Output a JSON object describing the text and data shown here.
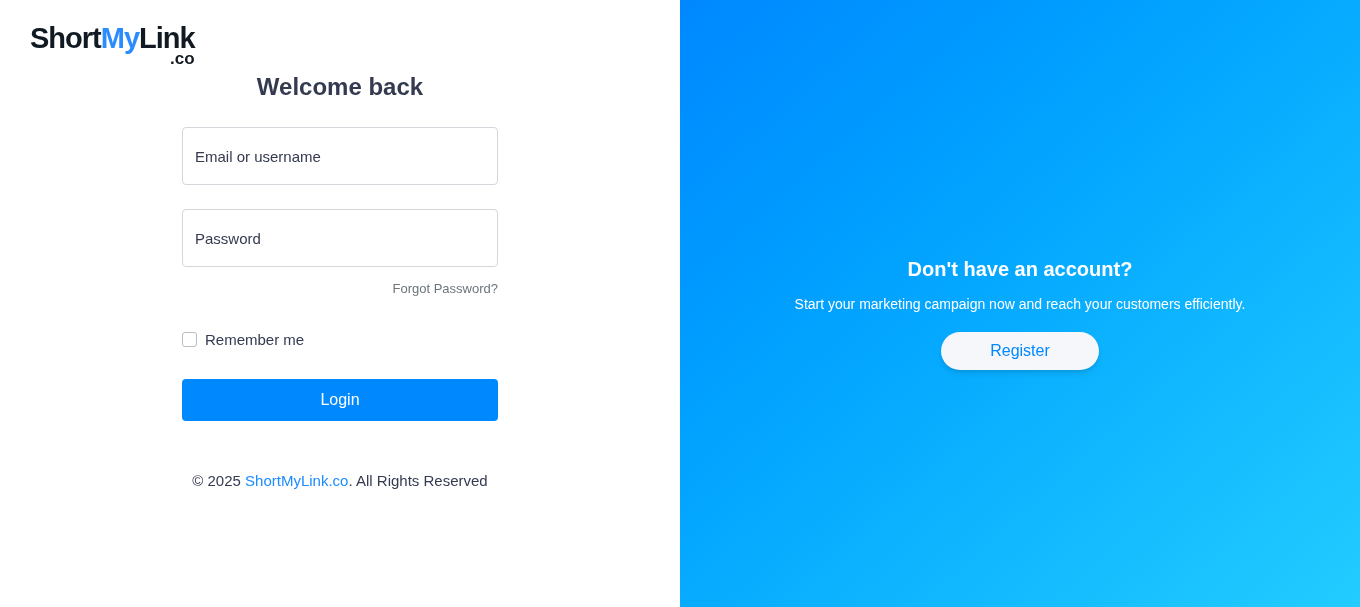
{
  "logo": {
    "parts": [
      {
        "text": "Short",
        "accent": false
      },
      {
        "text": "My",
        "accent": true
      },
      {
        "text": "Link",
        "accent": false
      }
    ],
    "suffix": ".co"
  },
  "login": {
    "title": "Welcome back",
    "fields": [
      {
        "placeholder": "Email or username"
      },
      {
        "placeholder": "Password"
      }
    ],
    "forgot": "Forgot Password?",
    "remember": {
      "label": "Remember me",
      "checked": false
    },
    "button": "Login",
    "footer": {
      "before": "© 2025 ",
      "link": "ShortMyLink.co",
      "after": ". All Rights Reserved"
    }
  },
  "promo": {
    "title": "Don't have an account?",
    "text": "Start your marketing campaign now and reach your customers efficiently.",
    "button": "Register"
  }
}
